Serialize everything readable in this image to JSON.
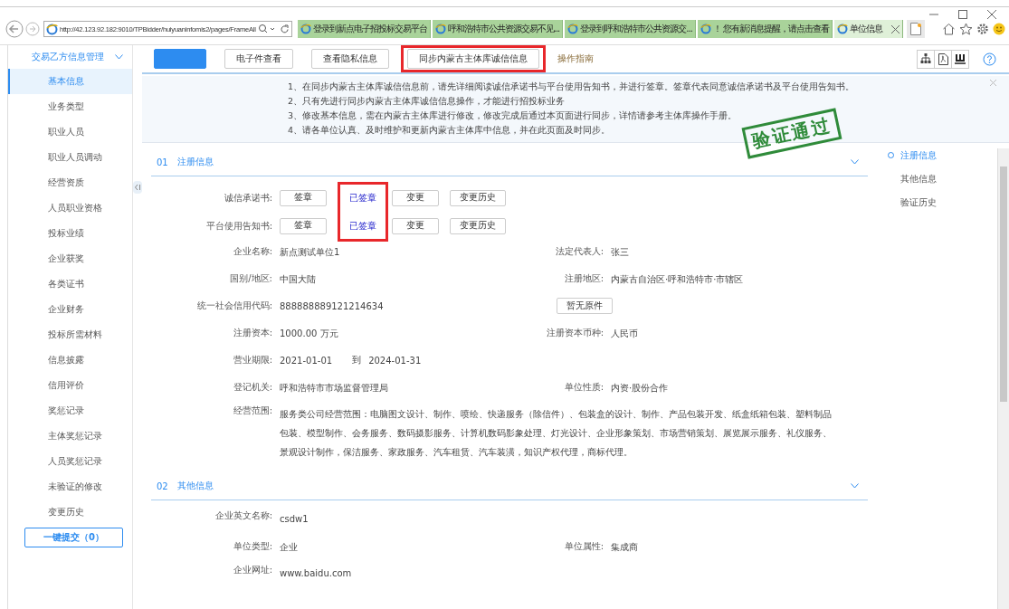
{
  "browser": {
    "address": "http://42.123.92.182:9010/TPBidder/huiyuaninfomis2/pages/FrameAll",
    "tabs": [
      {
        "title": "登录到新点电子招投标交易平台",
        "selected": false
      },
      {
        "title": "呼和浩特市公共资源交易不见...",
        "selected": false
      },
      {
        "title": "登录到呼和浩特市公共资源交...",
        "selected": false
      },
      {
        "title": "！ 您有新消息提醒，请点击查看",
        "selected": false
      },
      {
        "title": "单位信息",
        "selected": true
      }
    ]
  },
  "sidebar": {
    "title": "交易乙方信息管理",
    "items": [
      {
        "label": "基本信息",
        "selected": true
      },
      {
        "label": "业务类型",
        "selected": false
      },
      {
        "label": "职业人员",
        "selected": false
      },
      {
        "label": "职业人员调动",
        "selected": false
      },
      {
        "label": "经营资质",
        "selected": false
      },
      {
        "label": "人员职业资格",
        "selected": false
      },
      {
        "label": "投标业绩",
        "selected": false
      },
      {
        "label": "企业获奖",
        "selected": false
      },
      {
        "label": "各类证书",
        "selected": false
      },
      {
        "label": "企业财务",
        "selected": false
      },
      {
        "label": "投标所需材料",
        "selected": false
      },
      {
        "label": "信息披露",
        "selected": false
      },
      {
        "label": "信用评价",
        "selected": false
      },
      {
        "label": "奖惩记录",
        "selected": false
      },
      {
        "label": "主体奖惩记录",
        "selected": false
      },
      {
        "label": "人员奖惩记录",
        "selected": false
      },
      {
        "label": "未验证的修改",
        "selected": false
      },
      {
        "label": "变更历史",
        "selected": false
      }
    ],
    "submit_button": "一键提交（0）"
  },
  "toolbar": {
    "buttons": [
      {
        "kind": "blurred",
        "highlighted": false
      },
      {
        "kind": "plain",
        "label": "电子件查看",
        "highlighted": false
      },
      {
        "kind": "plain",
        "label": "查看隐私信息",
        "highlighted": false
      },
      {
        "kind": "plain",
        "label": "同步内蒙古主体库诚信信息",
        "highlighted": true
      },
      {
        "kind": "link",
        "label": "操作指南",
        "highlighted": false
      }
    ]
  },
  "notice": {
    "lines": [
      "1、在同步内蒙古主体库诚信信息前，请先详细阅读诚信承诺书与平台使用告知书，并进行签章。签章代表同意诚信承诺书及平台使用告知书。",
      "2、只有先进行同步内蒙古主体库诚信信息操作，才能进行招投标业务",
      "3、修改基本信息，需在内蒙古主体库进行修改，修改完成后通过本页面进行同步，详情请参考主体库操作手册。",
      "4、请各单位认真、及时维护和更新内蒙古主体库中信息，并在此页面及时同步。"
    ],
    "stamp": "验证通过"
  },
  "sections": [
    {
      "number": "01",
      "title": "注册信息",
      "status_highlighted": true,
      "documents": [
        {
          "label": "诚信承诺书:",
          "sign_button": "签章",
          "status": "已签章",
          "change_button": "变更",
          "history_button": "变更历史"
        },
        {
          "label": "平台使用告知书:",
          "sign_button": "签章",
          "status": "已签章",
          "change_button": "变更",
          "history_button": "变更历史"
        }
      ],
      "fields": [
        {
          "label": "企业名称:",
          "value": "新点测试单位1",
          "right_label": "法定代表人:",
          "right_value": "张三"
        },
        {
          "label": "国别/地区:",
          "value": "中国大陆",
          "right_label": "注册地区:",
          "right_value": "内蒙古自治区·呼和浩特市·市辖区"
        },
        {
          "label": "统一社会信用代码:",
          "value": "888888889121214634",
          "button": "暂无原件"
        },
        {
          "label": "注册资本:",
          "value": "1000.00 万元",
          "right_label": "注册资本币种:",
          "right_value": "人民币"
        },
        {
          "label": "营业期限:",
          "value": "2021-01-01",
          "separator": "到",
          "end_value": "2024-01-31"
        },
        {
          "label": "登记机关:",
          "value": "呼和浩特市市场监督管理局",
          "right_label": "单位性质:",
          "right_value": "内资·股份合作"
        },
        {
          "label": "经营范围:",
          "value": "服务类公司经营范围：电脑图文设计、制作、喷绘、快递服务（除信件）、包装盒的设计、制作、产品包装开发、纸盒纸箱包装、塑料制品包装、模型制作、会务服务、数码摄影服务、计算机数码影象处理、灯光设计、企业形象策划、市场营销策划、展览展示服务、礼仪服务、景观设计制作，保洁服务、家政服务、汽车租赁、汽车装潢，知识产权代理，商标代理。"
        }
      ]
    },
    {
      "number": "02",
      "title": "其他信息",
      "fields": [
        {
          "label": "企业英文名称:",
          "value": "csdw1"
        },
        {
          "label": "单位类型:",
          "value": "企业",
          "right_label": "单位属性:",
          "right_value": "集成商"
        },
        {
          "label": "企业网址:",
          "value": "www.baidu.com"
        }
      ]
    }
  ],
  "right_nav": [
    {
      "label": "注册信息",
      "selected": true
    },
    {
      "label": "其他信息",
      "selected": false
    },
    {
      "label": "验证历史",
      "selected": false
    }
  ]
}
